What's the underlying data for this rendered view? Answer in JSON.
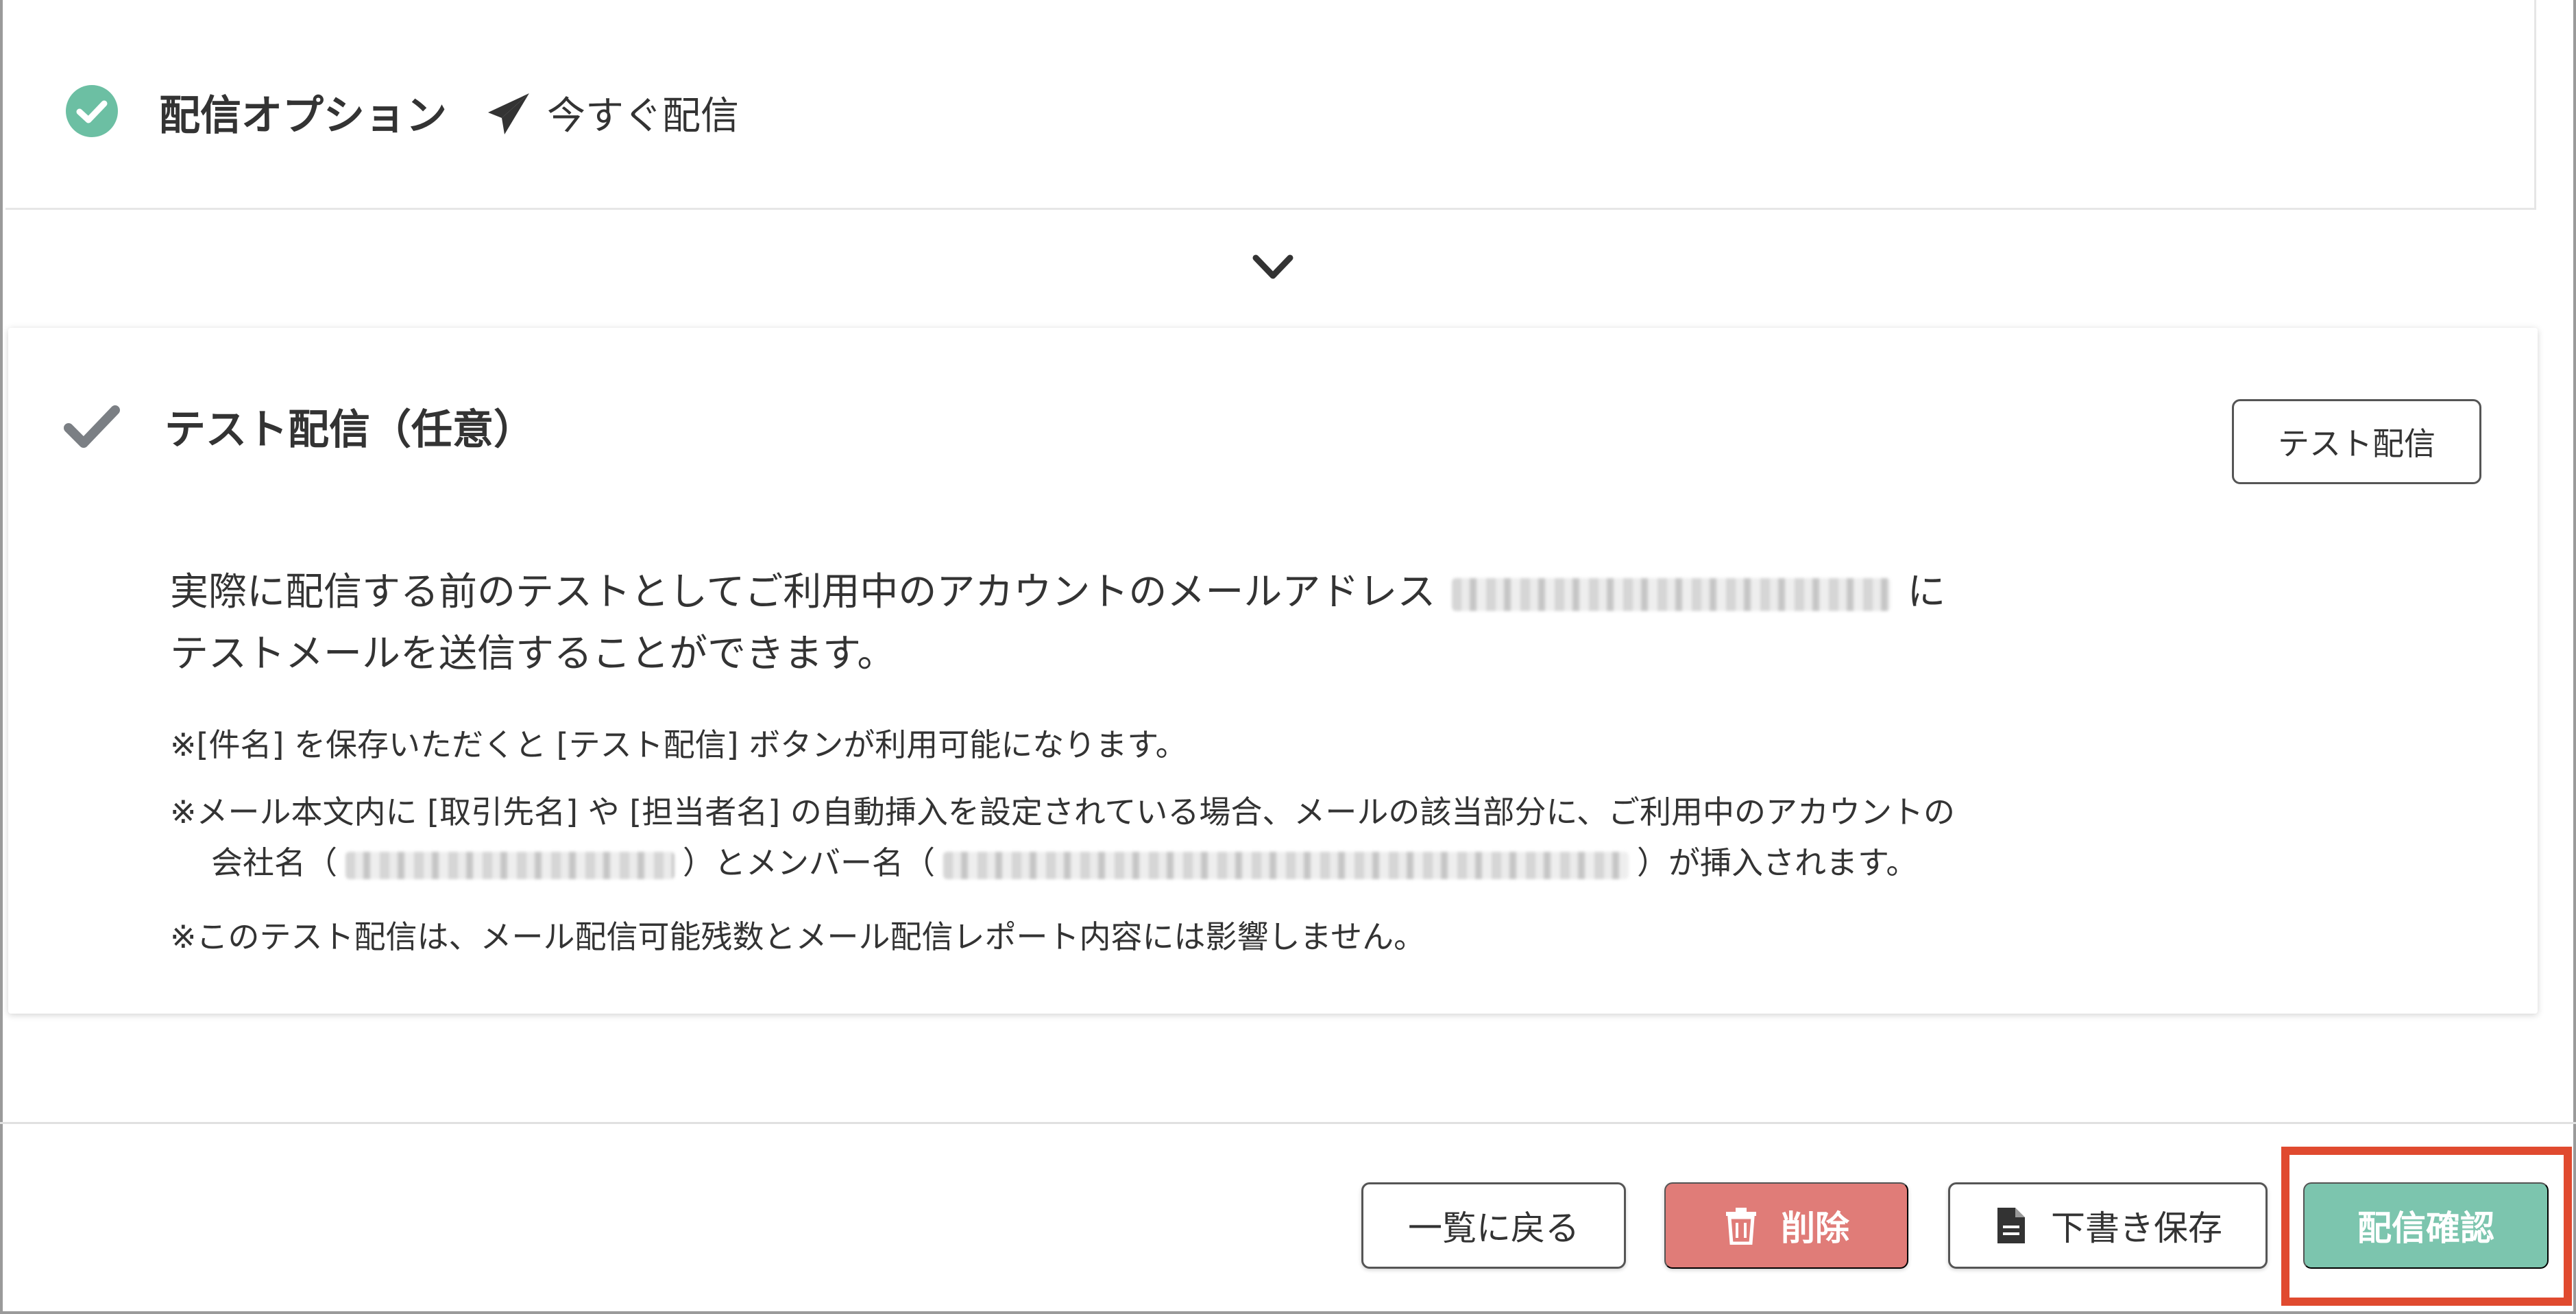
{
  "option_panel": {
    "title": "配信オプション",
    "value": "今すぐ配信"
  },
  "test_section": {
    "title": "テスト配信（任意）",
    "button_label": "テスト配信",
    "desc_line1_before": "実際に配信する前のテストとしてご利用中のアカウントのメールアドレス",
    "desc_line1_after": "に",
    "desc_line2": "テストメールを送信することができます。",
    "note1": "※[件名] を保存いただくと [テスト配信] ボタンが利用可能になります。",
    "note2": "※メール本文内に [取引先名] や [担当者名] の自動挿入を設定されている場合、メールの該当部分に、ご利用中のアカウントの",
    "note3_part1": "会社名（",
    "note3_part2": "）とメンバー名（",
    "note3_part3": "）が挿入されます。",
    "note4": "※このテスト配信は、メール配信可能残数とメール配信レポート内容には影響しません。"
  },
  "footer": {
    "back_label": "一覧に戻る",
    "delete_label": "削除",
    "draft_label": "下書き保存",
    "confirm_label": "配信確認"
  },
  "colors": {
    "accent_green": "#6cbfa3",
    "delete_red": "#e07c78",
    "confirm_green": "#7cc5ae",
    "highlight_red": "#e04a2f"
  }
}
